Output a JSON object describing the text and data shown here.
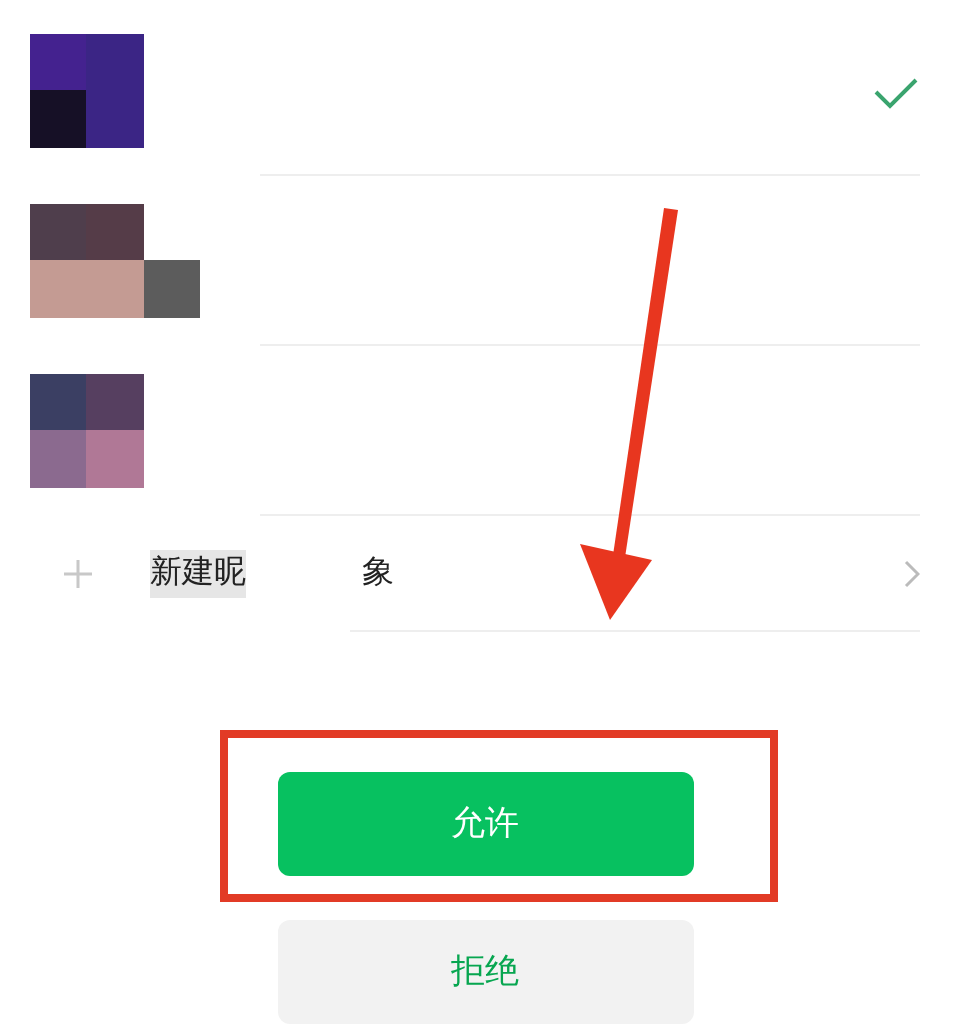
{
  "accounts": [
    {
      "kind": "avatar",
      "selected": true
    },
    {
      "kind": "avatar",
      "selected": false
    },
    {
      "kind": "avatar",
      "selected": false
    },
    {
      "kind": "new",
      "label_start": "新建昵",
      "label_end": "象"
    }
  ],
  "buttons": [
    {
      "kind": "primary",
      "label": "允许"
    },
    {
      "kind": "secondary",
      "label": "拒绝"
    }
  ]
}
